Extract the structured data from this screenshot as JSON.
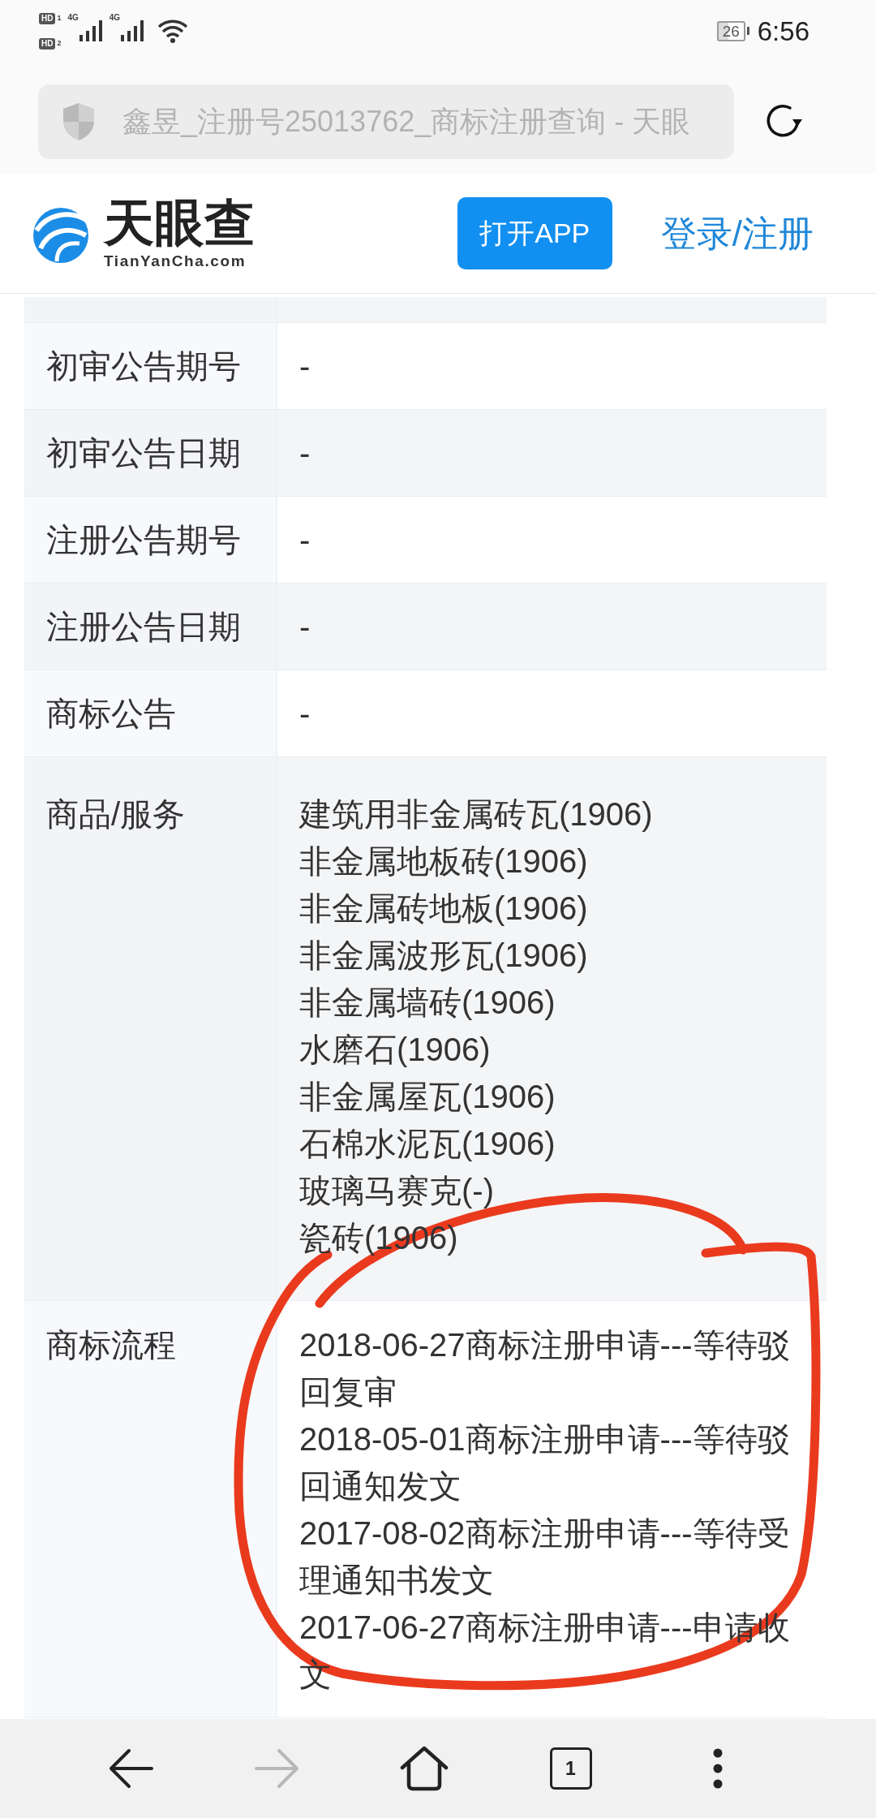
{
  "status_bar": {
    "sims": [
      {
        "badge": "HD",
        "slot": "1"
      },
      {
        "badge": "HD",
        "slot": "2"
      }
    ],
    "signals": [
      {
        "network": "4G"
      },
      {
        "network": "4G"
      }
    ],
    "battery": "26",
    "time": "6:56"
  },
  "address_bar": {
    "title": "鑫昱_注册号25013762_商标注册查询 - 天眼"
  },
  "header": {
    "logo_name": "天眼查",
    "logo_domain": "TianYanCha.com",
    "open_app_button": "打开APP",
    "login_link": "登录/注册"
  },
  "table": {
    "rows": [
      {
        "label": "初审公告期号",
        "kind": "text",
        "value": "-",
        "circled": false
      },
      {
        "label": "初审公告日期",
        "kind": "text",
        "value": "-",
        "circled": false
      },
      {
        "label": "注册公告期号",
        "kind": "text",
        "value": "-",
        "circled": false
      },
      {
        "label": "注册公告日期",
        "kind": "text",
        "value": "-",
        "circled": false
      },
      {
        "label": "商标公告",
        "kind": "text",
        "value": "-",
        "circled": false
      },
      {
        "label": "商品/服务",
        "kind": "list",
        "items": [
          "建筑用非金属砖瓦(1906)",
          "非金属地板砖(1906)",
          "非金属砖地板(1906)",
          "非金属波形瓦(1906)",
          "非金属墙砖(1906)",
          "水磨石(1906)",
          "非金属屋瓦(1906)",
          "石棉水泥瓦(1906)",
          "玻璃马赛克(-)",
          "瓷砖(1906)"
        ],
        "circled": false
      },
      {
        "label": "商标流程",
        "kind": "steps",
        "items": [
          "2018-06-27商标注册申请---等待驳回复审",
          "2018-05-01商标注册申请---等待驳回通知发文",
          "2017-08-02商标注册申请---等待受理通知书发文",
          "2017-06-27商标注册申请---申请收文"
        ],
        "circled": true
      }
    ]
  },
  "bottom_bar": {
    "buttons": [
      {
        "kind": "back",
        "disabled": false
      },
      {
        "kind": "forward",
        "disabled": true
      },
      {
        "kind": "home",
        "disabled": false
      },
      {
        "kind": "tabs",
        "count": "1",
        "disabled": false
      },
      {
        "kind": "menu",
        "disabled": false
      }
    ]
  }
}
